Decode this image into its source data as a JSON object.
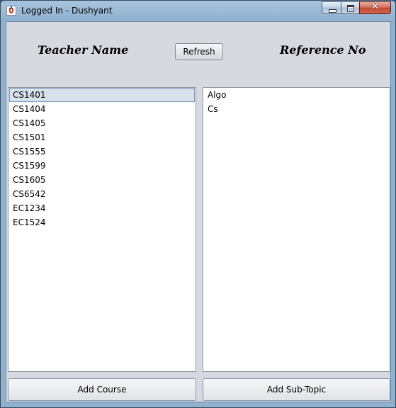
{
  "window": {
    "title": "Logged In - Dushyant"
  },
  "header": {
    "teacher_label": "Teacher Name",
    "refresh_label": "Refresh",
    "reference_label": "Reference No"
  },
  "courses": {
    "selected_index": 0,
    "items": [
      "CS1401",
      "CS1404",
      "CS1405",
      "CS1501",
      "CS1555",
      "CS1599",
      "CS1605",
      "CS6542",
      "EC1234",
      "EC1524"
    ]
  },
  "subtopics": {
    "items": [
      "Algo",
      "Cs"
    ]
  },
  "footer": {
    "add_course_label": "Add Course",
    "add_subtopic_label": "Add Sub-Topic"
  }
}
